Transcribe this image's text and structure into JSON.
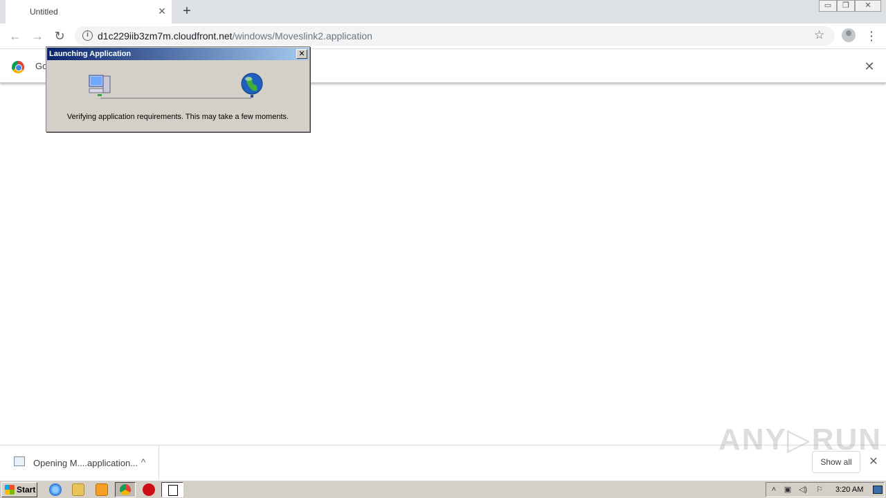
{
  "browser": {
    "tab": {
      "title": "Untitled",
      "close_glyph": "✕"
    },
    "new_tab_glyph": "+",
    "window_controls": {
      "minimize_glyph": "▭",
      "maximize_glyph": "❐",
      "close_glyph": "✕"
    },
    "nav": {
      "back_glyph": "←",
      "forward_glyph": "→",
      "reload_glyph": "↻"
    },
    "address_bar": {
      "domain": "d1c229iib3zm7m.cloudfront.net",
      "path": "/windows/Moveslink2.application",
      "info_glyph": "i",
      "star_glyph": "☆"
    },
    "menu_glyph": "⋮"
  },
  "infobar": {
    "text": "Go",
    "close_glyph": "✕"
  },
  "dialog": {
    "title": "Launching Application",
    "close_glyph": "✕",
    "message": "Verifying application requirements. This may take a few moments."
  },
  "download_shelf": {
    "item_label": "Opening M....application...",
    "chevron_glyph": "^",
    "show_all_label": "Show all",
    "close_glyph": "✕",
    "watermark": "ANY▷RUN"
  },
  "taskbar": {
    "start_label": "Start",
    "tray": {
      "chevron_glyph": "˄",
      "network_glyph": "▣",
      "volume_glyph": "◁)",
      "flag_glyph": "⚐"
    },
    "clock": "3:20 AM"
  },
  "icons": {
    "dialog_left": "computer-icon",
    "dialog_right": "globe-icon"
  }
}
